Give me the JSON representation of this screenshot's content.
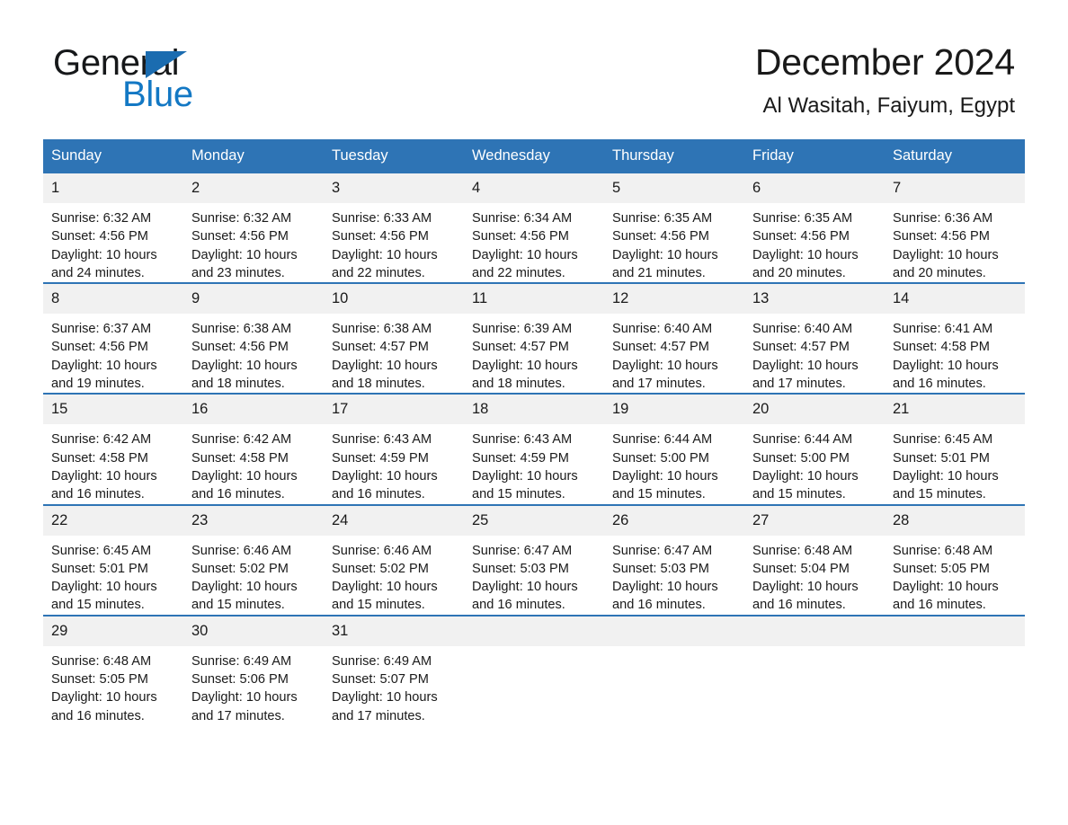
{
  "brand": {
    "name_part1": "General",
    "name_part2": "Blue",
    "triangle_color": "#1b6cb0",
    "blue_color": "#1378c4"
  },
  "header": {
    "title": "December 2024",
    "subtitle": "Al Wasitah, Faiyum, Egypt"
  },
  "theme": {
    "header_blue": "#2e74b5",
    "daynum_background": "#f1f1f1",
    "text_color": "#1a1a1a"
  },
  "weekday_headers": [
    "Sunday",
    "Monday",
    "Tuesday",
    "Wednesday",
    "Thursday",
    "Friday",
    "Saturday"
  ],
  "weeks": [
    [
      {
        "day": "1",
        "sunrise": "Sunrise: 6:32 AM",
        "sunset": "Sunset: 4:56 PM",
        "daylight": "Daylight: 10 hours and 24 minutes."
      },
      {
        "day": "2",
        "sunrise": "Sunrise: 6:32 AM",
        "sunset": "Sunset: 4:56 PM",
        "daylight": "Daylight: 10 hours and 23 minutes."
      },
      {
        "day": "3",
        "sunrise": "Sunrise: 6:33 AM",
        "sunset": "Sunset: 4:56 PM",
        "daylight": "Daylight: 10 hours and 22 minutes."
      },
      {
        "day": "4",
        "sunrise": "Sunrise: 6:34 AM",
        "sunset": "Sunset: 4:56 PM",
        "daylight": "Daylight: 10 hours and 22 minutes."
      },
      {
        "day": "5",
        "sunrise": "Sunrise: 6:35 AM",
        "sunset": "Sunset: 4:56 PM",
        "daylight": "Daylight: 10 hours and 21 minutes."
      },
      {
        "day": "6",
        "sunrise": "Sunrise: 6:35 AM",
        "sunset": "Sunset: 4:56 PM",
        "daylight": "Daylight: 10 hours and 20 minutes."
      },
      {
        "day": "7",
        "sunrise": "Sunrise: 6:36 AM",
        "sunset": "Sunset: 4:56 PM",
        "daylight": "Daylight: 10 hours and 20 minutes."
      }
    ],
    [
      {
        "day": "8",
        "sunrise": "Sunrise: 6:37 AM",
        "sunset": "Sunset: 4:56 PM",
        "daylight": "Daylight: 10 hours and 19 minutes."
      },
      {
        "day": "9",
        "sunrise": "Sunrise: 6:38 AM",
        "sunset": "Sunset: 4:56 PM",
        "daylight": "Daylight: 10 hours and 18 minutes."
      },
      {
        "day": "10",
        "sunrise": "Sunrise: 6:38 AM",
        "sunset": "Sunset: 4:57 PM",
        "daylight": "Daylight: 10 hours and 18 minutes."
      },
      {
        "day": "11",
        "sunrise": "Sunrise: 6:39 AM",
        "sunset": "Sunset: 4:57 PM",
        "daylight": "Daylight: 10 hours and 18 minutes."
      },
      {
        "day": "12",
        "sunrise": "Sunrise: 6:40 AM",
        "sunset": "Sunset: 4:57 PM",
        "daylight": "Daylight: 10 hours and 17 minutes."
      },
      {
        "day": "13",
        "sunrise": "Sunrise: 6:40 AM",
        "sunset": "Sunset: 4:57 PM",
        "daylight": "Daylight: 10 hours and 17 minutes."
      },
      {
        "day": "14",
        "sunrise": "Sunrise: 6:41 AM",
        "sunset": "Sunset: 4:58 PM",
        "daylight": "Daylight: 10 hours and 16 minutes."
      }
    ],
    [
      {
        "day": "15",
        "sunrise": "Sunrise: 6:42 AM",
        "sunset": "Sunset: 4:58 PM",
        "daylight": "Daylight: 10 hours and 16 minutes."
      },
      {
        "day": "16",
        "sunrise": "Sunrise: 6:42 AM",
        "sunset": "Sunset: 4:58 PM",
        "daylight": "Daylight: 10 hours and 16 minutes."
      },
      {
        "day": "17",
        "sunrise": "Sunrise: 6:43 AM",
        "sunset": "Sunset: 4:59 PM",
        "daylight": "Daylight: 10 hours and 16 minutes."
      },
      {
        "day": "18",
        "sunrise": "Sunrise: 6:43 AM",
        "sunset": "Sunset: 4:59 PM",
        "daylight": "Daylight: 10 hours and 15 minutes."
      },
      {
        "day": "19",
        "sunrise": "Sunrise: 6:44 AM",
        "sunset": "Sunset: 5:00 PM",
        "daylight": "Daylight: 10 hours and 15 minutes."
      },
      {
        "day": "20",
        "sunrise": "Sunrise: 6:44 AM",
        "sunset": "Sunset: 5:00 PM",
        "daylight": "Daylight: 10 hours and 15 minutes."
      },
      {
        "day": "21",
        "sunrise": "Sunrise: 6:45 AM",
        "sunset": "Sunset: 5:01 PM",
        "daylight": "Daylight: 10 hours and 15 minutes."
      }
    ],
    [
      {
        "day": "22",
        "sunrise": "Sunrise: 6:45 AM",
        "sunset": "Sunset: 5:01 PM",
        "daylight": "Daylight: 10 hours and 15 minutes."
      },
      {
        "day": "23",
        "sunrise": "Sunrise: 6:46 AM",
        "sunset": "Sunset: 5:02 PM",
        "daylight": "Daylight: 10 hours and 15 minutes."
      },
      {
        "day": "24",
        "sunrise": "Sunrise: 6:46 AM",
        "sunset": "Sunset: 5:02 PM",
        "daylight": "Daylight: 10 hours and 15 minutes."
      },
      {
        "day": "25",
        "sunrise": "Sunrise: 6:47 AM",
        "sunset": "Sunset: 5:03 PM",
        "daylight": "Daylight: 10 hours and 16 minutes."
      },
      {
        "day": "26",
        "sunrise": "Sunrise: 6:47 AM",
        "sunset": "Sunset: 5:03 PM",
        "daylight": "Daylight: 10 hours and 16 minutes."
      },
      {
        "day": "27",
        "sunrise": "Sunrise: 6:48 AM",
        "sunset": "Sunset: 5:04 PM",
        "daylight": "Daylight: 10 hours and 16 minutes."
      },
      {
        "day": "28",
        "sunrise": "Sunrise: 6:48 AM",
        "sunset": "Sunset: 5:05 PM",
        "daylight": "Daylight: 10 hours and 16 minutes."
      }
    ],
    [
      {
        "day": "29",
        "sunrise": "Sunrise: 6:48 AM",
        "sunset": "Sunset: 5:05 PM",
        "daylight": "Daylight: 10 hours and 16 minutes."
      },
      {
        "day": "30",
        "sunrise": "Sunrise: 6:49 AM",
        "sunset": "Sunset: 5:06 PM",
        "daylight": "Daylight: 10 hours and 17 minutes."
      },
      {
        "day": "31",
        "sunrise": "Sunrise: 6:49 AM",
        "sunset": "Sunset: 5:07 PM",
        "daylight": "Daylight: 10 hours and 17 minutes."
      },
      {
        "day": "",
        "sunrise": "",
        "sunset": "",
        "daylight": ""
      },
      {
        "day": "",
        "sunrise": "",
        "sunset": "",
        "daylight": ""
      },
      {
        "day": "",
        "sunrise": "",
        "sunset": "",
        "daylight": ""
      },
      {
        "day": "",
        "sunrise": "",
        "sunset": "",
        "daylight": ""
      }
    ]
  ]
}
